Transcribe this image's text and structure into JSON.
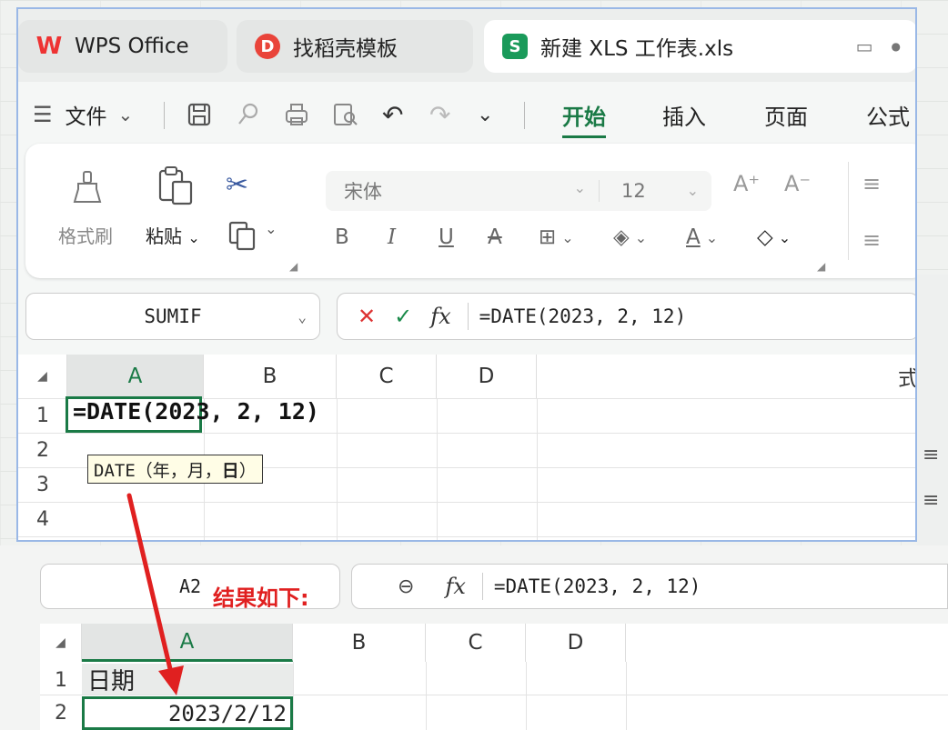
{
  "tabs": [
    {
      "label": "WPS Office",
      "icon": "wps-logo-icon"
    },
    {
      "label": "找稻壳模板",
      "icon": "docer-logo-icon"
    },
    {
      "label": "新建 XLS 工作表.xls",
      "icon": "spreadsheet-s-icon"
    }
  ],
  "icons": {
    "wps": "W",
    "docer": "D",
    "sheet": "S",
    "tablet": "▭",
    "dot": "●",
    "hamburger": "☰",
    "chevron": "⌄",
    "save": "🖫",
    "undo": "↶",
    "redo": "↷",
    "cross": "✕",
    "check": "✓",
    "fx": "fx",
    "zoom": "⊖",
    "bold": "B",
    "italic": "I",
    "underline": "U",
    "strike": "A",
    "border": "⊞",
    "fill": "◈",
    "fontcolor": "A",
    "eraser": "◇",
    "format_painter": "🖌",
    "paste": "📋",
    "scissors": "✂",
    "copy": "⧉",
    "font_grow": "A⁺",
    "font_shrink": "A⁻",
    "align": "≡"
  },
  "menu": {
    "file": "文件",
    "tabs": [
      "开始",
      "插入",
      "页面",
      "公式"
    ]
  },
  "ribbon": {
    "format_painter": "格式刷",
    "paste": "粘贴",
    "font_name": "宋体",
    "font_size": "12"
  },
  "top_formula_bar": {
    "name_box": "SUMIF",
    "fx_label": "fx",
    "formula": "=DATE(2023, 2, 12)"
  },
  "top_sheet": {
    "columns": [
      "A",
      "B",
      "C",
      "D"
    ],
    "right_edge_text": "式",
    "rows": [
      "1",
      "2",
      "3",
      "4"
    ],
    "cell_a1": "=DATE(2023, 2, 12)",
    "tooltip_prefix": "DATE（年，月，",
    "tooltip_bold": "日",
    "tooltip_suffix": "）"
  },
  "annotation": {
    "text": "结果如下:",
    "color": "#e02020"
  },
  "bottom_formula_bar": {
    "name_box": "A2",
    "fx_label": "fx",
    "formula": "=DATE(2023, 2, 12)"
  },
  "bottom_sheet": {
    "columns": [
      "A",
      "B",
      "C",
      "D"
    ],
    "rows": [
      "1",
      "2"
    ],
    "cell_a1": "日期",
    "cell_a2": "2023/2/12"
  },
  "colors": {
    "accent_green": "#1a7a46",
    "window_border": "#9ab8e6",
    "arrow_red": "#e02020"
  }
}
